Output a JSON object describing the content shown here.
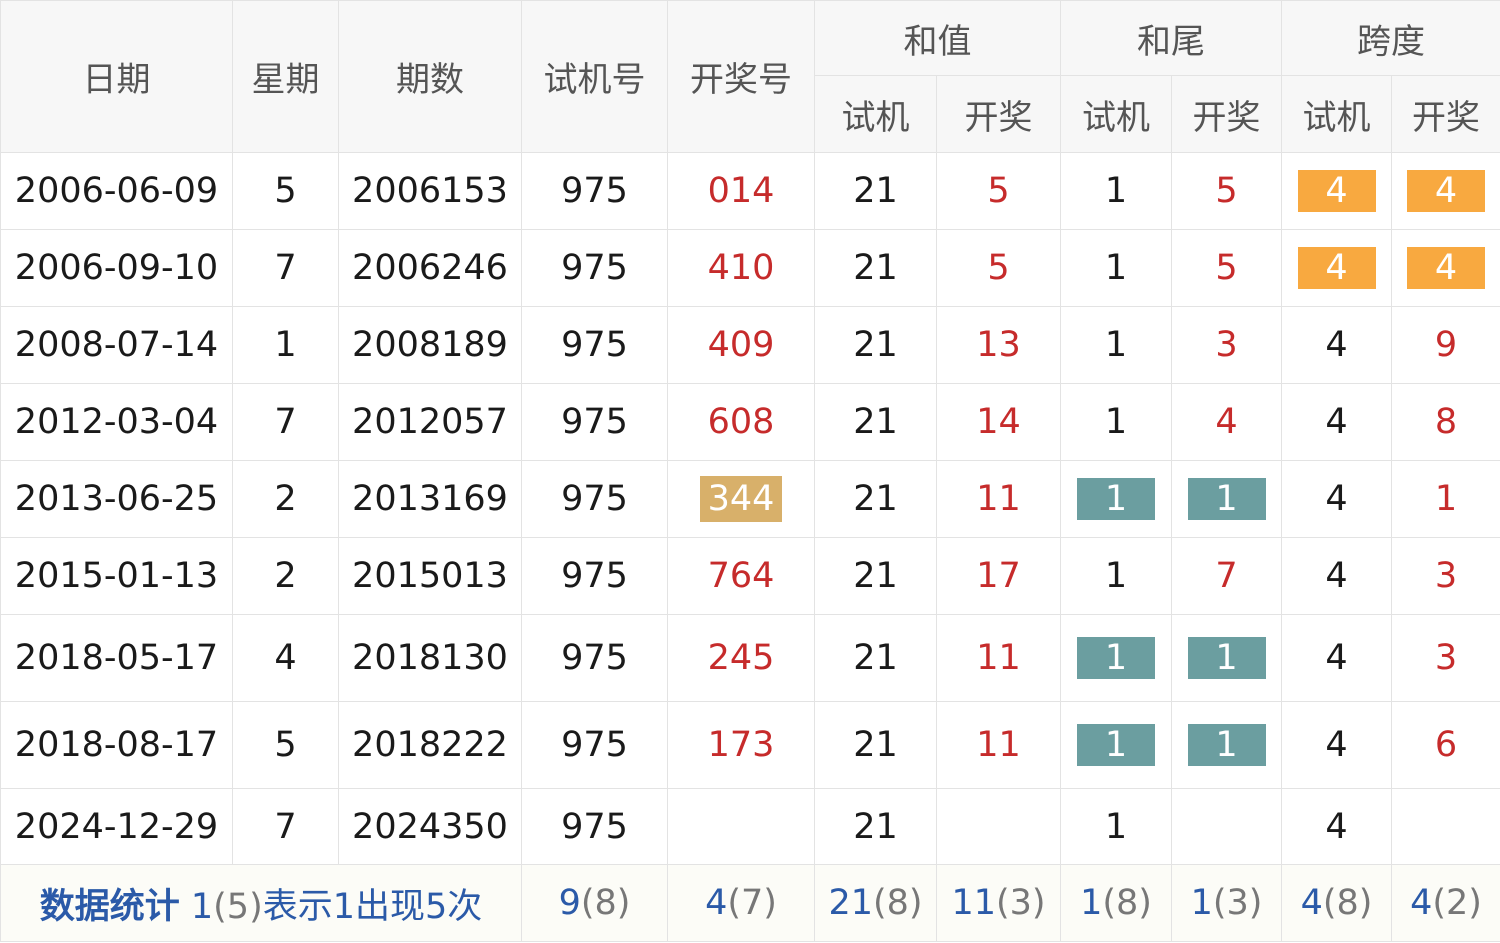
{
  "headers": {
    "date": "日期",
    "weekday": "星期",
    "issue": "期数",
    "trial_no": "试机号",
    "draw_no": "开奖号",
    "sum_group": "和值",
    "tail_group": "和尾",
    "span_group": "跨度",
    "sub_trial": "试机",
    "sub_draw": "开奖"
  },
  "rows": [
    {
      "date": "2006-06-09",
      "weekday": "5",
      "issue": "2006153",
      "trial": "975",
      "draw": "014",
      "sum_trial": "21",
      "sum_draw": "5",
      "tail_trial": "1",
      "tail_draw": "5",
      "span_trial": "4",
      "span_draw": "4"
    },
    {
      "date": "2006-09-10",
      "weekday": "7",
      "issue": "2006246",
      "trial": "975",
      "draw": "410",
      "sum_trial": "21",
      "sum_draw": "5",
      "tail_trial": "1",
      "tail_draw": "5",
      "span_trial": "4",
      "span_draw": "4"
    },
    {
      "date": "2008-07-14",
      "weekday": "1",
      "issue": "2008189",
      "trial": "975",
      "draw": "409",
      "sum_trial": "21",
      "sum_draw": "13",
      "tail_trial": "1",
      "tail_draw": "3",
      "span_trial": "4",
      "span_draw": "9"
    },
    {
      "date": "2012-03-04",
      "weekday": "7",
      "issue": "2012057",
      "trial": "975",
      "draw": "608",
      "sum_trial": "21",
      "sum_draw": "14",
      "tail_trial": "1",
      "tail_draw": "4",
      "span_trial": "4",
      "span_draw": "8"
    },
    {
      "date": "2013-06-25",
      "weekday": "2",
      "issue": "2013169",
      "trial": "975",
      "draw": "344",
      "sum_trial": "21",
      "sum_draw": "11",
      "tail_trial": "1",
      "tail_draw": "1",
      "span_trial": "4",
      "span_draw": "1"
    },
    {
      "date": "2015-01-13",
      "weekday": "2",
      "issue": "2015013",
      "trial": "975",
      "draw": "764",
      "sum_trial": "21",
      "sum_draw": "17",
      "tail_trial": "1",
      "tail_draw": "7",
      "span_trial": "4",
      "span_draw": "3"
    },
    {
      "date": "2018-05-17",
      "weekday": "4",
      "issue": "2018130",
      "trial": "975",
      "draw": "245",
      "sum_trial": "21",
      "sum_draw": "11",
      "tail_trial": "1",
      "tail_draw": "1",
      "span_trial": "4",
      "span_draw": "3"
    },
    {
      "date": "2018-08-17",
      "weekday": "5",
      "issue": "2018222",
      "trial": "975",
      "draw": "173",
      "sum_trial": "21",
      "sum_draw": "11",
      "tail_trial": "1",
      "tail_draw": "1",
      "span_trial": "4",
      "span_draw": "6"
    },
    {
      "date": "2024-12-29",
      "weekday": "7",
      "issue": "2024350",
      "trial": "975",
      "draw": "",
      "sum_trial": "21",
      "sum_draw": "",
      "tail_trial": "1",
      "tail_draw": "",
      "span_trial": "4",
      "span_draw": ""
    }
  ],
  "stats": {
    "title": "数据统计",
    "note_value": "1",
    "note_count": "(5)",
    "note_text": "表示1出现5次",
    "trial": {
      "v": "9",
      "c": "(8)"
    },
    "draw": {
      "v": "4",
      "c": "(7)"
    },
    "sum_trial": {
      "v": "21",
      "c": "(8)"
    },
    "sum_draw": {
      "v": "11",
      "c": "(3)"
    },
    "tail_trial": {
      "v": "1",
      "c": "(8)"
    },
    "tail_draw": {
      "v": "1",
      "c": "(3)"
    },
    "span_trial": {
      "v": "4",
      "c": "(8)"
    },
    "span_draw": {
      "v": "4",
      "c": "(2)"
    }
  },
  "colors": {
    "draw_text": "#c62b2b",
    "highlight_orange": "#f8a940",
    "highlight_tan": "#d8b06a",
    "highlight_teal": "#6b9ea0",
    "stats_text": "#2b5aa8"
  }
}
